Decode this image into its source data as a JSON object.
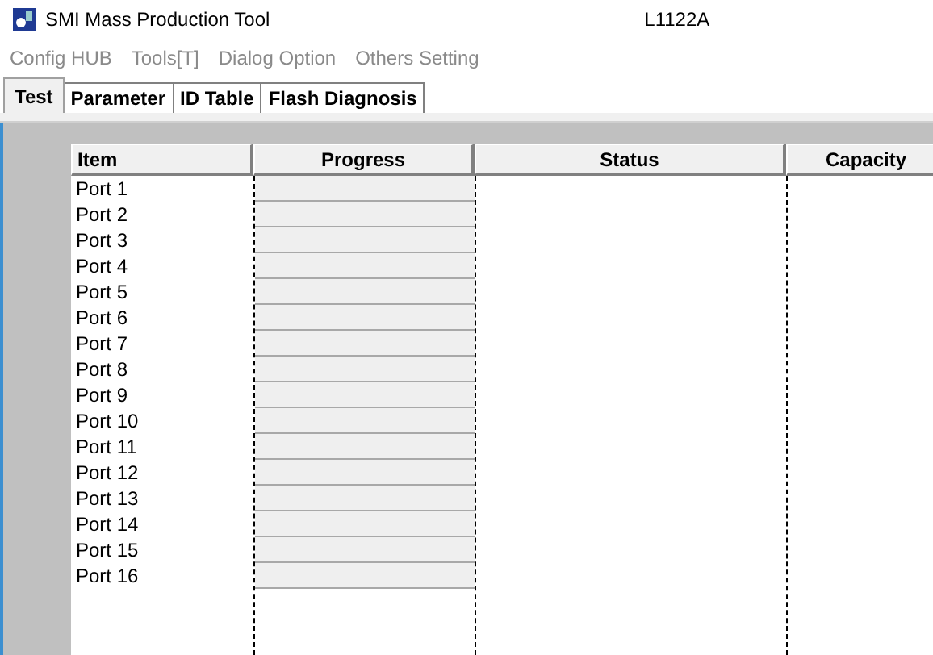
{
  "window": {
    "title": "SMI Mass Production Tool",
    "version": "L1122A"
  },
  "menu": [
    "Config HUB",
    "Tools[T]",
    "Dialog Option",
    "Others Setting"
  ],
  "tabs": [
    {
      "label": "Test",
      "selected": true
    },
    {
      "label": "Parameter",
      "selected": false
    },
    {
      "label": "ID Table",
      "selected": false
    },
    {
      "label": "Flash Diagnosis",
      "selected": false
    }
  ],
  "table": {
    "columns": [
      "Item",
      "Progress",
      "Status",
      "Capacity"
    ],
    "rows": [
      {
        "item": "Port 1",
        "level": 0
      },
      {
        "item": "Port 2",
        "level": 0
      },
      {
        "item": "Port 3",
        "level": 0
      },
      {
        "item": "Port 4",
        "level": 0
      },
      {
        "item": "Port 5",
        "level": 0
      },
      {
        "item": "Port 6",
        "level": 0
      },
      {
        "item": "Port 7",
        "level": 0
      },
      {
        "item": "Port 8",
        "level": 0
      },
      {
        "item": "Port 9",
        "level": 0
      },
      {
        "item": "Port 10",
        "level": 0
      },
      {
        "item": "Port 11",
        "level": 0
      },
      {
        "item": "Port 12",
        "level": 0
      },
      {
        "item": "Port 13",
        "level": 0
      },
      {
        "item": "Port 14",
        "level": 0
      },
      {
        "item": "Port 15",
        "level": 0
      },
      {
        "item": "Port 16",
        "level": 0
      }
    ]
  }
}
